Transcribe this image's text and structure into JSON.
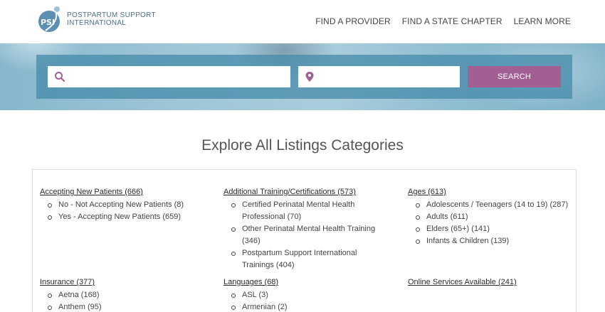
{
  "logo": {
    "mark": "PSI",
    "line1": "POSTPARTUM SUPPORT",
    "line2": "INTERNATIONAL"
  },
  "nav": [
    "FIND A PROVIDER",
    "FIND A STATE CHAPTER",
    "LEARN MORE"
  ],
  "search": {
    "keyword_placeholder": "",
    "location_placeholder": "",
    "button_label": "SEARCH"
  },
  "page_title": "Explore All Listings Categories",
  "categories": {
    "accepting": {
      "title": "Accepting New Patients (666)",
      "items": [
        "No - Not Accepting New Patients (8)",
        "Yes - Accepting New Patients (659)"
      ]
    },
    "training": {
      "title": "Additional Training/Certifications (573)",
      "items": [
        "Certified Perinatal Mental Health Professional (70)",
        "Other Perinatal Mental Health Training (346)",
        "Postpartum Support International Trainings (404)"
      ]
    },
    "ages": {
      "title": "Ages (613)",
      "items": [
        "Adolescents / Teenagers (14 to 19) (287)",
        "Adults (611)",
        "Elders (65+) (141)",
        "Infants & Children (139)"
      ]
    },
    "insurance": {
      "title": "Insurance (377)",
      "items": [
        "Aetna (168)",
        "Anthem (95)"
      ]
    },
    "languages": {
      "title": "Languages (68)",
      "items": [
        "ASL (3)",
        "Armenian (2)"
      ]
    },
    "online": {
      "title": "Online Services Available (241)",
      "items": []
    }
  },
  "colors": {
    "accent": "#a25f92",
    "nav_text": "#444444",
    "search_panel": "#4589aa",
    "logo_blue": "#4a6f88"
  }
}
